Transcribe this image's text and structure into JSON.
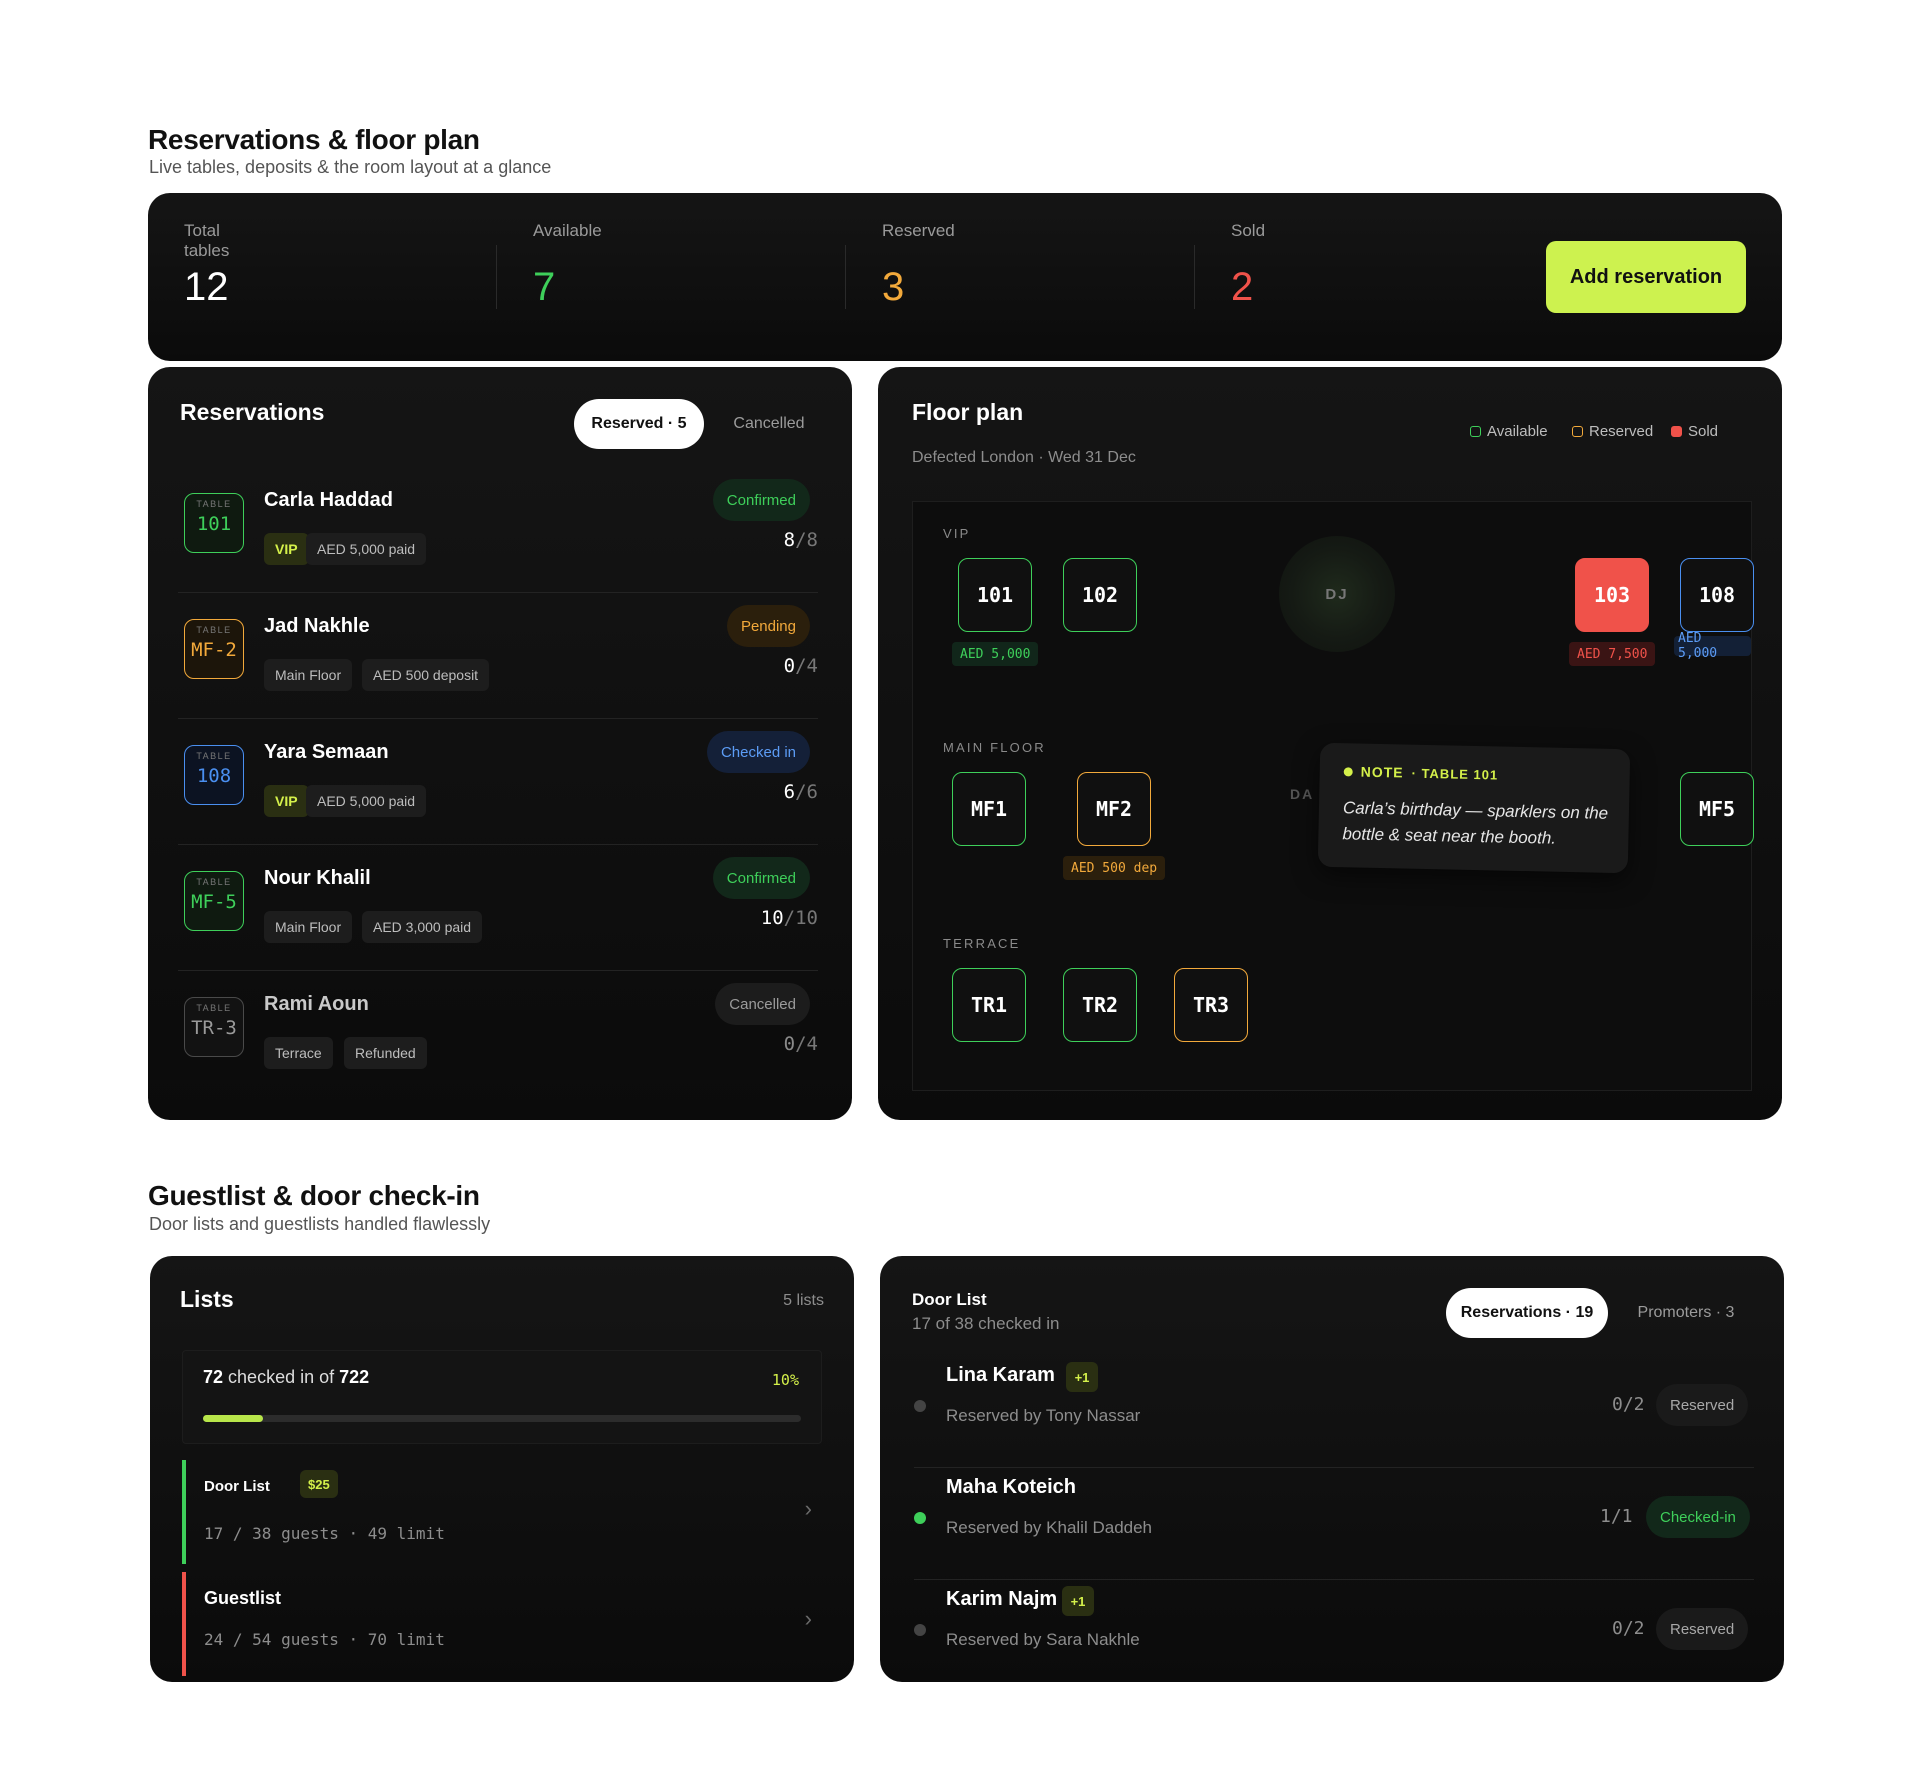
{
  "reservations_section": {
    "title": "Reservations & floor plan",
    "subtitle": "Live tables, deposits & the room layout at a glance"
  },
  "stats": [
    {
      "label": "Total tables",
      "value": "12",
      "color": "#ffffff"
    },
    {
      "label": "Available",
      "value": "7",
      "color": "#3ecf5a"
    },
    {
      "label": "Reserved",
      "value": "3",
      "color": "#f2a93b"
    },
    {
      "label": "Sold",
      "value": "2",
      "color": "#f0524a"
    }
  ],
  "add_reservation_label": "Add reservation",
  "reservations": {
    "title": "Reservations",
    "tabs": [
      {
        "label": "Reserved · 5"
      },
      {
        "label": "Cancelled"
      }
    ],
    "table_label": "TABLE",
    "rows": [
      {
        "table": "101",
        "table_color": "#3ecf5a",
        "name": "Carla Haddad",
        "chips": [
          "VIP",
          "AED 5,000 paid"
        ],
        "status": "Confirmed",
        "count_a": "8",
        "count_b": "8"
      },
      {
        "table": "MF-2",
        "table_color": "#f2a93b",
        "name": "Jad Nakhle",
        "chips": [
          "Main Floor",
          "AED 500 deposit"
        ],
        "status": "Pending",
        "count_a": "0",
        "count_b": "4"
      },
      {
        "table": "108",
        "table_color": "#4a8ff0",
        "name": "Yara Semaan",
        "chips": [
          "VIP",
          "AED 5,000 paid"
        ],
        "status": "Checked in",
        "count_a": "6",
        "count_b": "6"
      },
      {
        "table": "MF-5",
        "table_color": "#3ecf5a",
        "name": "Nour Khalil",
        "chips": [
          "Main Floor",
          "AED 3,000 paid"
        ],
        "status": "Confirmed",
        "count_a": "10",
        "count_b": "10"
      },
      {
        "table": "TR-3",
        "table_color": "#555555",
        "name": "Rami Aoun",
        "chips": [
          "Terrace",
          "Refunded"
        ],
        "status": "Cancelled",
        "count_a": "0",
        "count_b": "4"
      }
    ]
  },
  "floor_plan": {
    "title": "Floor plan",
    "subtitle": "Defected London · Wed 31 Dec",
    "legend": [
      {
        "label": "Available",
        "color": "#3ecf5a"
      },
      {
        "label": "Reserved",
        "color": "#f2a93b"
      },
      {
        "label": "Sold",
        "color": "#f0524a"
      }
    ],
    "zones": {
      "vip": "VIP",
      "main": "MAIN FLOOR",
      "terrace": "TERRACE"
    },
    "dj": "DJ",
    "hidden_label": "DA",
    "tables": {
      "t101": "101",
      "t102": "102",
      "t103": "103",
      "t108": "108",
      "mf1": "MF1",
      "mf2": "MF2",
      "mf5": "MF5",
      "tr1": "TR1",
      "tr2": "TR2",
      "tr3": "TR3"
    },
    "tags": {
      "t101": "AED 5,000",
      "t103": "AED 7,500",
      "t108": "AED 5,000",
      "mf2": "AED 500 dep"
    },
    "note": {
      "head_a": "NOTE",
      "head_b": "· TABLE 101",
      "text": "Carla’s birthday — sparklers on the bottle & seat near the booth."
    }
  },
  "guestlist_section": {
    "title": "Guestlist & door check-in",
    "subtitle": "Door lists and guestlists handled flawlessly"
  },
  "lists": {
    "title": "Lists",
    "count": "5 lists",
    "checked": "72",
    "checked_mid": "checked in of",
    "total": "722",
    "percent_label": "10%",
    "progress": 0.1,
    "items": [
      {
        "name": "Door List",
        "price": "$25",
        "meta": "17 / 38 guests · 49 limit",
        "color": "#3ecf5a"
      },
      {
        "name": "Guestlist",
        "price": "",
        "meta": "24 / 54 guests · 70 limit",
        "color": "#f0524a"
      }
    ]
  },
  "door_list": {
    "title": "Door List",
    "subtitle": "17 of 38 checked in",
    "tabs": [
      {
        "label": "Reservations · 19"
      },
      {
        "label": "Promoters · 3"
      }
    ],
    "guests": [
      {
        "name": "Lina Karam",
        "plus": "+1",
        "by": "Reserved by Tony Nassar",
        "count": "0/2",
        "status": "Reserved",
        "dot": "#444444"
      },
      {
        "name": "Maha Koteich",
        "plus": "",
        "by": "Reserved by Khalil Daddeh",
        "count": "1/1",
        "status": "Checked-in",
        "dot": "#3ecf5a"
      },
      {
        "name": "Karim Najm",
        "plus": "+1",
        "by": "Reserved by Sara Nakhle",
        "count": "0/2",
        "status": "Reserved",
        "dot": "#444444"
      }
    ]
  }
}
